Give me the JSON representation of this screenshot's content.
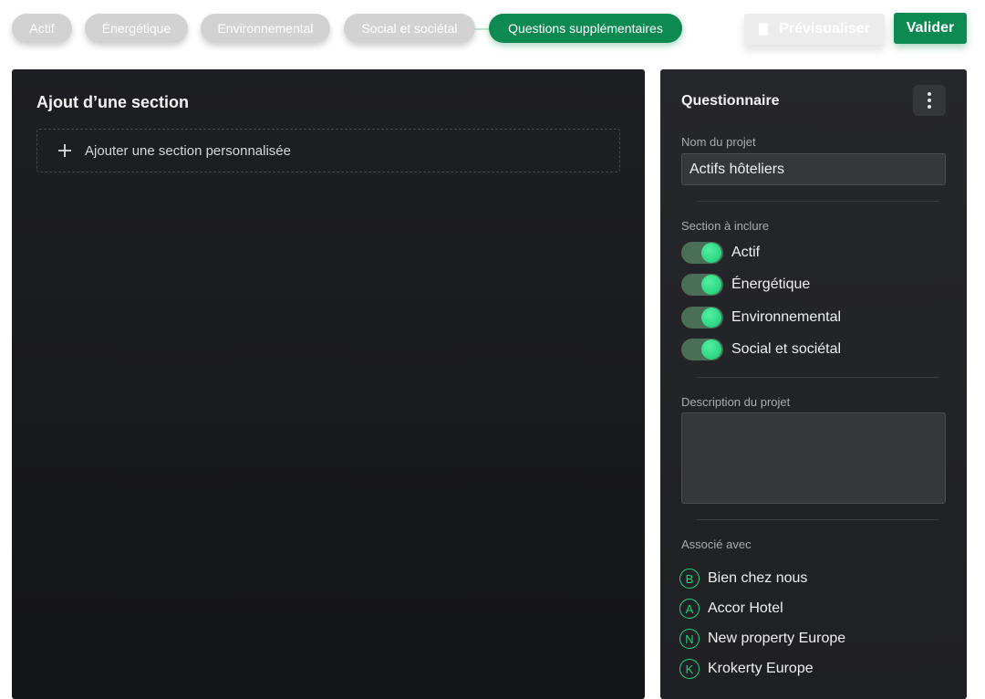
{
  "stepper": {
    "steps": [
      {
        "label": "Actif",
        "active": false
      },
      {
        "label": "Énergétique",
        "active": false
      },
      {
        "label": "Environnemental",
        "active": false
      },
      {
        "label": "Social et sociétal",
        "active": false
      },
      {
        "label": "Questions supplémentaires",
        "active": true
      }
    ]
  },
  "actions": {
    "preview_label": "Prévisualiser",
    "validate_label": "Valider"
  },
  "left": {
    "title": "Ajout d’une section",
    "add_section_label": "Ajouter une section personnalisée"
  },
  "questionnaire": {
    "title": "Questionnaire",
    "project_name_label": "Nom du projet",
    "project_name_value": "Actifs hôteliers",
    "sections_label": "Section à inclure",
    "sections": [
      {
        "label": "Actif",
        "enabled": true
      },
      {
        "label": "Énergétique",
        "enabled": true
      },
      {
        "label": "Environnemental",
        "enabled": true
      },
      {
        "label": "Social et sociétal",
        "enabled": true
      }
    ],
    "description_label": "Description du projet",
    "description_value": "",
    "associated_label": "Associé avec",
    "associated": [
      {
        "initial": "B",
        "name": "Bien chez nous"
      },
      {
        "initial": "A",
        "name": "Accor Hotel"
      },
      {
        "initial": "N",
        "name": "New property Europe"
      },
      {
        "initial": "K",
        "name": "Krokerty Europe"
      }
    ]
  },
  "colors": {
    "accent": "#0d8a52",
    "toggle_on": "#1fd27f",
    "panel_bg": "#1e1f22"
  }
}
